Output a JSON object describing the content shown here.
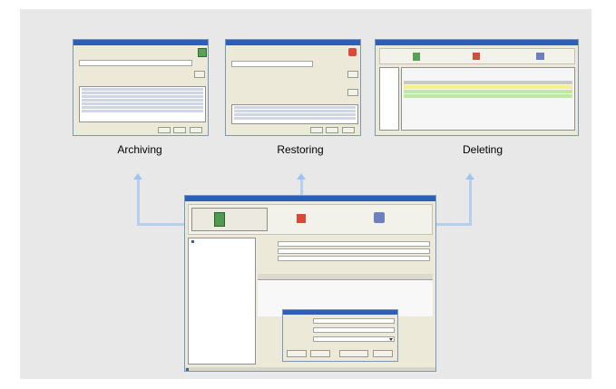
{
  "captions": {
    "archiving": "Archiving",
    "restoring": "Restoring",
    "deleting": "Deleting"
  },
  "archive_window": {
    "field_value": "",
    "buttons": [
      "",
      "",
      ""
    ]
  },
  "restore_window": {
    "field_value": "",
    "buttons": [
      "",
      "",
      ""
    ]
  },
  "delete_window": {
    "toolbar": [
      "",
      "",
      ""
    ]
  },
  "main_window": {
    "toolbar": [
      "",
      "",
      ""
    ],
    "tree_root": "",
    "dialog": {
      "title": "",
      "fields": [
        "",
        "",
        ""
      ],
      "buttons": [
        "",
        "",
        "",
        ""
      ]
    }
  },
  "colors": {
    "arrow": "#9cc6f0",
    "highlight_yellow": "#f7f08a",
    "highlight_green": "#bfe7a5",
    "titlebar": "#2e5fb8"
  }
}
